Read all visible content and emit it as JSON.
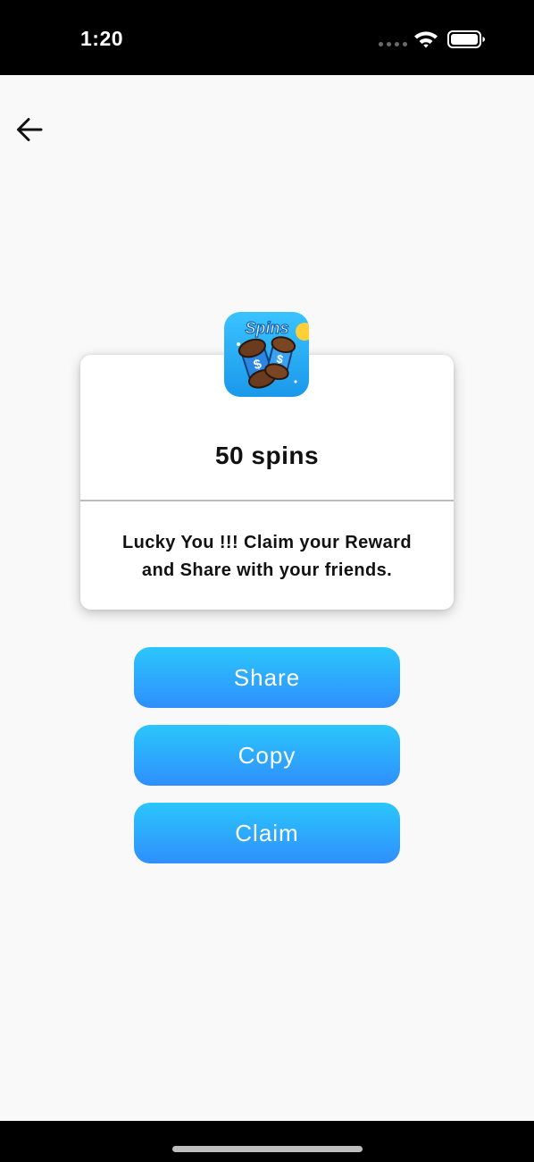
{
  "status_bar": {
    "time": "1:20"
  },
  "reward": {
    "icon_label": "Spins",
    "title": "50 spins",
    "message_line1": "Lucky You !!! Claim your Reward",
    "message_line2": "and Share with your friends."
  },
  "buttons": {
    "share_label": "Share",
    "copy_label": "Copy",
    "claim_label": "Claim"
  },
  "colors": {
    "button_gradient_top": "#2bc6fb",
    "button_gradient_bottom": "#2f8ffd",
    "background": "#f9f9f9",
    "app_icon_bg": "#1fa4ee"
  }
}
